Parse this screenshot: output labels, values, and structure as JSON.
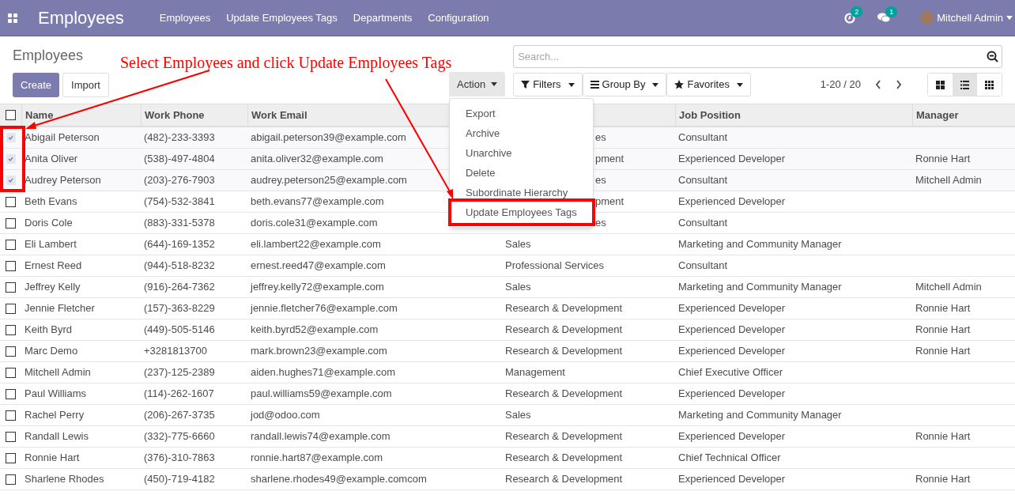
{
  "navbar": {
    "app_title": "Employees",
    "menu": [
      "Employees",
      "Update Employees Tags",
      "Departments",
      "Configuration"
    ],
    "activity_count": "2",
    "message_count": "1",
    "user": "Mitchell Admin"
  },
  "breadcrumb": "Employees",
  "buttons": [
    "Create",
    "Import"
  ],
  "search": {
    "placeholder": "Search..."
  },
  "action_button": "Action",
  "search_buttons": [
    "Filters",
    "Group By",
    "Favorites"
  ],
  "pager": "1-20 / 20",
  "views": [
    {
      "kind": "kanban",
      "selected": false
    },
    {
      "kind": "list",
      "selected": true
    },
    {
      "kind": "grid",
      "selected": false
    }
  ],
  "action_menu": {
    "items": [
      "Export",
      "Archive",
      "Unarchive",
      "Delete",
      "Subordinate Hierarchy",
      "Update Employees Tags"
    ]
  },
  "table": {
    "all_selected": false,
    "columns": [
      "Name",
      "Work Phone",
      "Work Email",
      "",
      "Job Position",
      "Manager"
    ],
    "rows": [
      {
        "selected": true,
        "cells": [
          "Abigail Peterson",
          "(482)-233-3393",
          "abigail.peterson39@example.com",
          "es",
          "Consultant",
          ""
        ]
      },
      {
        "selected": true,
        "cells": [
          "Anita Oliver",
          "(538)-497-4804",
          "anita.oliver32@example.com",
          "pment",
          "Experienced Developer",
          "Ronnie Hart"
        ]
      },
      {
        "selected": true,
        "cells": [
          "Audrey Peterson",
          "(203)-276-7903",
          "audrey.peterson25@example.com",
          "es",
          "Consultant",
          "Mitchell Admin"
        ]
      },
      {
        "selected": false,
        "cells": [
          "Beth Evans",
          "(754)-532-3841",
          "beth.evans77@example.com",
          "pment",
          "Experienced Developer",
          ""
        ]
      },
      {
        "selected": false,
        "cells": [
          "Doris Cole",
          "(883)-331-5378",
          "doris.cole31@example.com",
          "es",
          "Consultant",
          ""
        ]
      },
      {
        "selected": false,
        "cells": [
          "Eli Lambert",
          "(644)-169-1352",
          "eli.lambert22@example.com",
          "Sales",
          "Marketing and Community Manager",
          ""
        ]
      },
      {
        "selected": false,
        "cells": [
          "Ernest Reed",
          "(944)-518-8232",
          "ernest.reed47@example.com",
          "Professional Services",
          "Consultant",
          ""
        ]
      },
      {
        "selected": false,
        "cells": [
          "Jeffrey Kelly",
          "(916)-264-7362",
          "jeffrey.kelly72@example.com",
          "Sales",
          "Marketing and Community Manager",
          "Mitchell Admin"
        ]
      },
      {
        "selected": false,
        "cells": [
          "Jennie Fletcher",
          "(157)-363-8229",
          "jennie.fletcher76@example.com",
          "Research & Development",
          "Experienced Developer",
          "Ronnie Hart"
        ]
      },
      {
        "selected": false,
        "cells": [
          "Keith Byrd",
          "(449)-505-5146",
          "keith.byrd52@example.com",
          "Research & Development",
          "Experienced Developer",
          "Ronnie Hart"
        ]
      },
      {
        "selected": false,
        "cells": [
          "Marc Demo",
          "+3281813700",
          "mark.brown23@example.com",
          "Research & Development",
          "Experienced Developer",
          "Ronnie Hart"
        ]
      },
      {
        "selected": false,
        "cells": [
          "Mitchell Admin",
          "(237)-125-2389",
          "aiden.hughes71@example.com",
          "Management",
          "Chief Executive Officer",
          ""
        ]
      },
      {
        "selected": false,
        "cells": [
          "Paul Williams",
          "(114)-262-1607",
          "paul.williams59@example.com",
          "Research & Development",
          "Experienced Developer",
          ""
        ]
      },
      {
        "selected": false,
        "cells": [
          "Rachel Perry",
          "(206)-267-3735",
          "jod@odoo.com",
          "Sales",
          "Marketing and Community Manager",
          ""
        ]
      },
      {
        "selected": false,
        "cells": [
          "Randall Lewis",
          "(332)-775-6660",
          "randall.lewis74@example.com",
          "Research & Development",
          "Experienced Developer",
          "Ronnie Hart"
        ]
      },
      {
        "selected": false,
        "cells": [
          "Ronnie Hart",
          "(376)-310-7863",
          "ronnie.hart87@example.com",
          "Research & Development",
          "Chief Technical Officer",
          ""
        ]
      },
      {
        "selected": false,
        "cells": [
          "Sharlene Rhodes",
          "(450)-719-4182",
          "sharlene.rhodes49@example.comcom",
          "Research & Development",
          "Experienced Developer",
          "Ronnie Hart"
        ]
      }
    ]
  },
  "annotation": {
    "text": "Select Employees and click Update Employees Tags"
  }
}
